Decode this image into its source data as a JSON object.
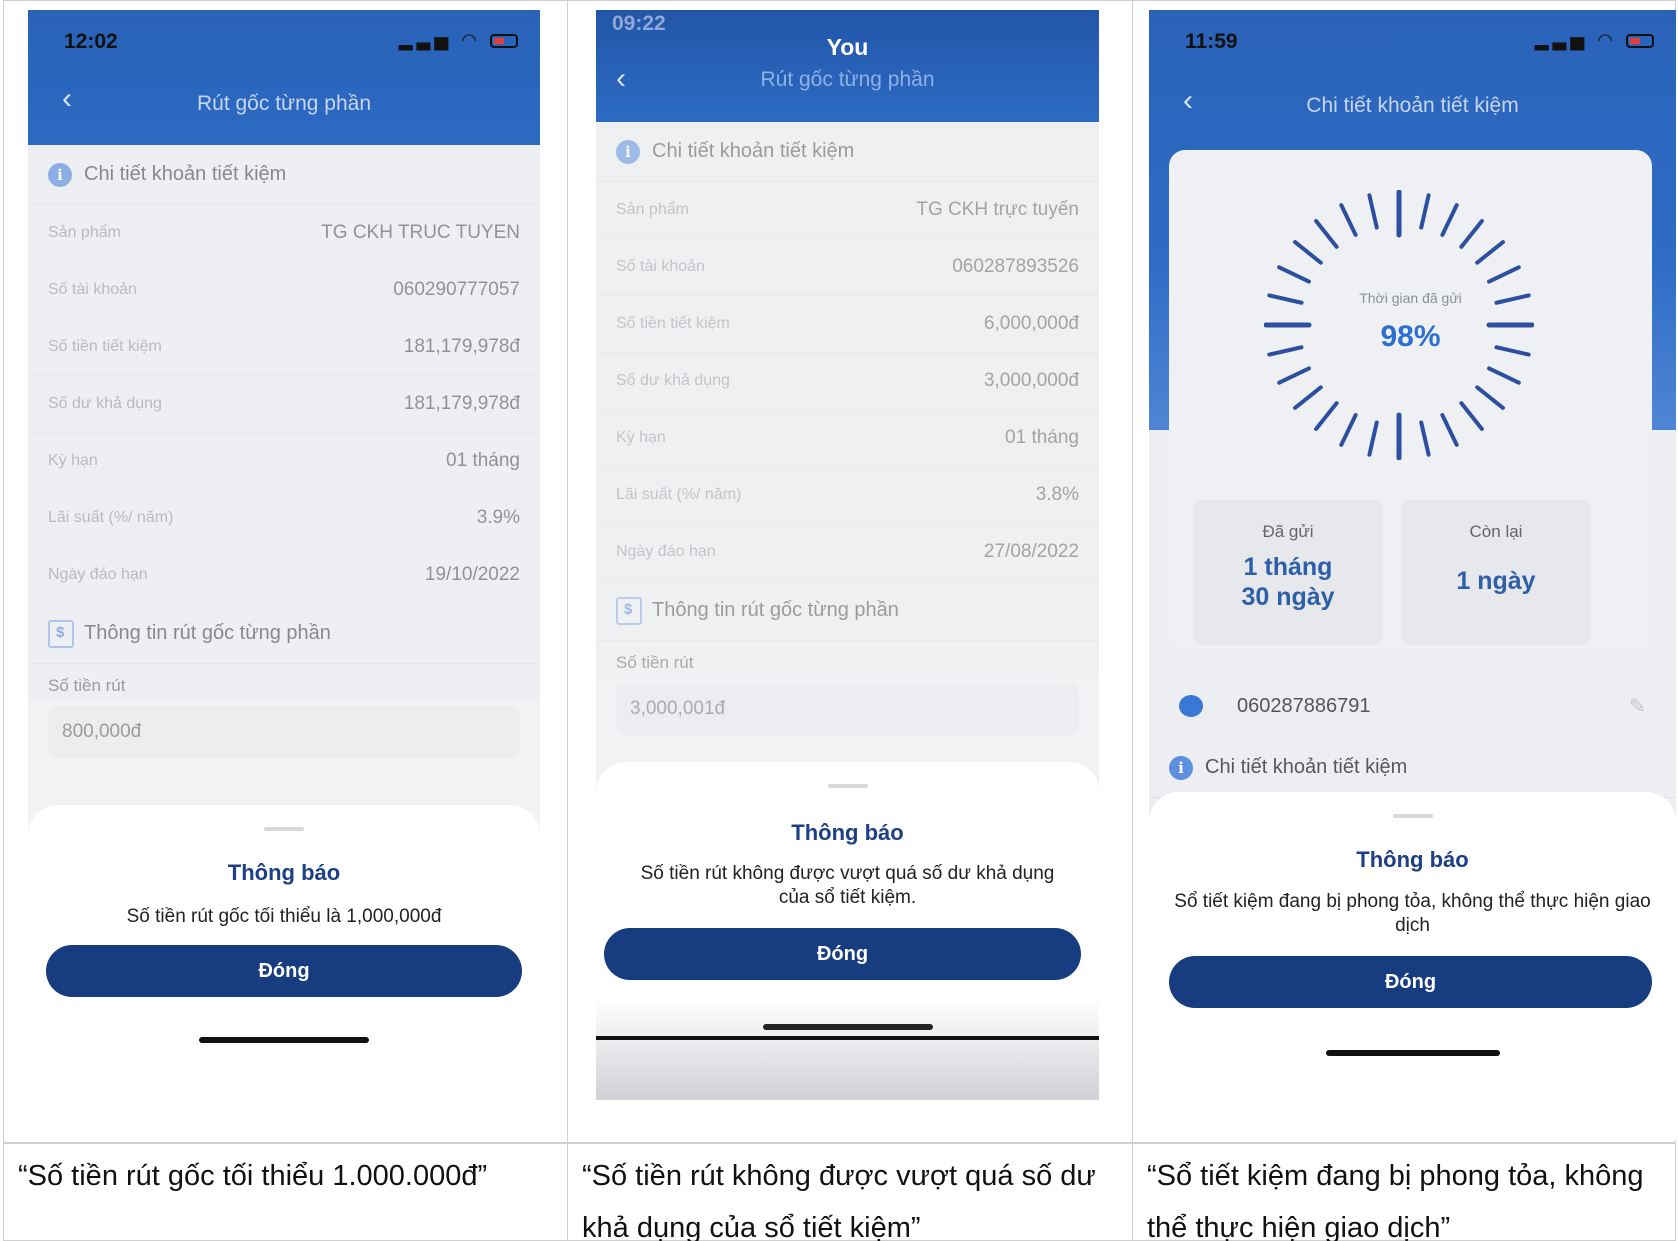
{
  "panels": [
    {
      "time": "12:02",
      "header_title": "Rút gốc từng phần",
      "section1": "Chi tiết khoản tiết kiệm",
      "rows": [
        {
          "k": "Sản phẩm",
          "v": "TG CKH TRUC TUYEN"
        },
        {
          "k": "Số tài khoản",
          "v": "060290777057"
        },
        {
          "k": "Số tiền tiết kiệm",
          "v": "181,179,978đ"
        },
        {
          "k": "Số dư khả dụng",
          "v": "181,179,978đ"
        },
        {
          "k": "Kỳ hạn",
          "v": "01 tháng"
        },
        {
          "k": "Lãi suất (%/ năm)",
          "v": "3.9%"
        },
        {
          "k": "Ngày đáo hạn",
          "v": "19/10/2022"
        }
      ],
      "section2": "Thông tin rút gốc từng phần",
      "field_label": "Số tiền rút",
      "field_value": "800,000đ",
      "sheet_title": "Thông báo",
      "sheet_msg": "Số tiền rút gốc tối thiểu là 1,000,000đ",
      "button": "Đóng",
      "caption": "“Số tiền rút gốc tối thiểu 1.000.000đ”"
    },
    {
      "time": "09:22",
      "header_top": "You",
      "header_title": "Rút gốc từng phần",
      "section1": "Chi tiết khoản tiết kiệm",
      "rows": [
        {
          "k": "Sản phẩm",
          "v": "TG CKH trực tuyến"
        },
        {
          "k": "Số tài khoản",
          "v": "060287893526"
        },
        {
          "k": "Số tiền tiết kiệm",
          "v": "6,000,000đ"
        },
        {
          "k": "Số dư khả dụng",
          "v": "3,000,000đ"
        },
        {
          "k": "Kỳ hạn",
          "v": "01 tháng"
        },
        {
          "k": "Lãi suất (%/ năm)",
          "v": "3.8%"
        },
        {
          "k": "Ngày đáo hạn",
          "v": "27/08/2022"
        }
      ],
      "section2": "Thông tin rút gốc từng phần",
      "field_label": "Số tiền rút",
      "field_value": "3,000,001đ",
      "sheet_title": "Thông báo",
      "sheet_msg": "Số tiền rút không được vượt quá số dư khả dụng của sổ tiết kiệm.",
      "button": "Đóng",
      "caption": "“Số tiền rút không được vượt quá số dư khả dụng của sổ tiết kiệm”"
    },
    {
      "time": "11:59",
      "header_title": "Chi tiết khoản tiết kiệm",
      "ring_label": "Thời gian đã gửi",
      "ring_value": "98%",
      "ring_progress": 0.98,
      "sent_label": "Đã gửi",
      "sent_value_1": "1 tháng",
      "sent_value_2": "30 ngày",
      "left_label": "Còn lại",
      "left_value": "1 ngày",
      "account": "060287886791",
      "section1": "Chi tiết khoản tiết kiệm",
      "sheet_title": "Thông báo",
      "sheet_msg": "Sổ tiết kiệm đang bị phong tỏa, không thể thực hiện giao dịch",
      "button": "Đóng",
      "caption": "“Sổ tiết kiệm đang bị phong tỏa, không thể thực hiện giao dịch”"
    }
  ],
  "colors": {
    "header": "#2c6ac2",
    "button": "#173d80",
    "title": "#1d3f86",
    "accent": "#2d6fd0"
  },
  "icons": [
    "back-chevron-icon",
    "info-icon",
    "money-bag-icon",
    "piggy-bank-icon",
    "pencil-icon",
    "signal-icon",
    "wifi-icon",
    "battery-icon"
  ]
}
